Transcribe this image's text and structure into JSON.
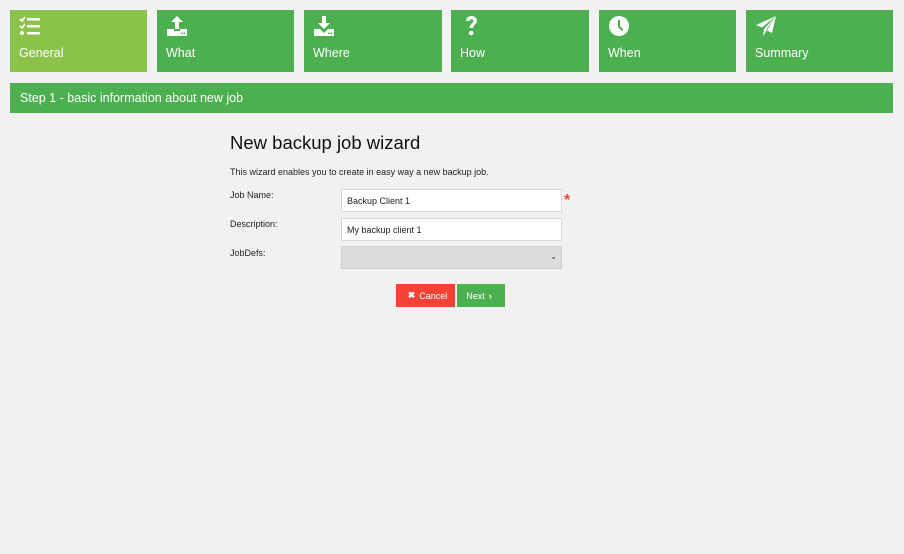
{
  "steps": [
    {
      "label": "General",
      "icon": "tasks-list-icon",
      "active": true
    },
    {
      "label": "What",
      "icon": "upload-icon",
      "active": false
    },
    {
      "label": "Where",
      "icon": "download-icon",
      "active": false
    },
    {
      "label": "How",
      "icon": "question-icon",
      "active": false
    },
    {
      "label": "When",
      "icon": "clock-icon",
      "active": false
    },
    {
      "label": "Summary",
      "icon": "paper-plane-icon",
      "active": false
    }
  ],
  "step_bar": {
    "text": "Step 1 - basic information about new job"
  },
  "wizard": {
    "title": "New backup job wizard",
    "intro": "This wizard enables you to create in easy way a new backup job.",
    "fields": {
      "job_name": {
        "label": "Job Name:",
        "value": "Backup Client 1",
        "required_marker": "*"
      },
      "description": {
        "label": "Description:",
        "value": "My backup client 1"
      },
      "jobdefs": {
        "label": "JobDefs:",
        "value": ""
      }
    },
    "buttons": {
      "cancel": {
        "label": "Cancel",
        "icon_glyph": "✖"
      },
      "next": {
        "label": "Next",
        "icon_glyph": "›"
      }
    }
  },
  "colors": {
    "primary": "#4caf50",
    "active_step": "#8bc34a",
    "danger": "#f44336",
    "background": "#f1f1f1"
  }
}
